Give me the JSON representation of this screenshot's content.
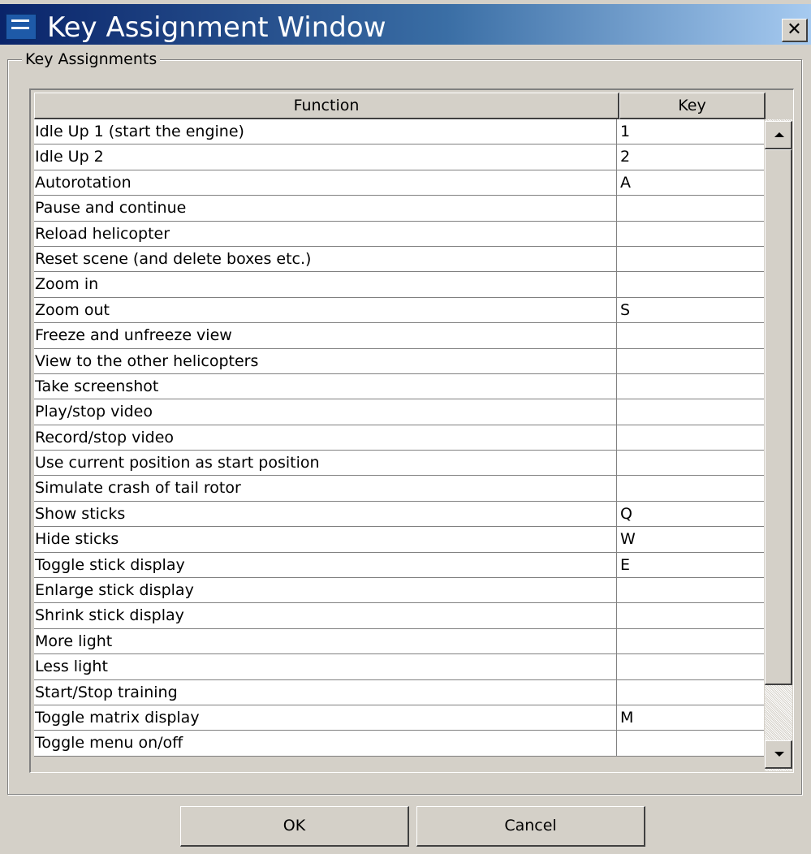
{
  "window": {
    "title": "Key Assignment Window",
    "close_label": "✕"
  },
  "group": {
    "label": "Key Assignments"
  },
  "table": {
    "columns": [
      "Function",
      "Key"
    ],
    "rows": [
      {
        "function": "Idle Up 1 (start the engine)",
        "key": "1"
      },
      {
        "function": "Idle Up 2",
        "key": "2"
      },
      {
        "function": "Autorotation",
        "key": "A"
      },
      {
        "function": "Pause and continue",
        "key": ""
      },
      {
        "function": "Reload helicopter",
        "key": ""
      },
      {
        "function": "Reset scene (and delete boxes etc.)",
        "key": ""
      },
      {
        "function": "Zoom in",
        "key": ""
      },
      {
        "function": "Zoom out",
        "key": "S"
      },
      {
        "function": "Freeze and unfreeze view",
        "key": ""
      },
      {
        "function": "View to the other helicopters",
        "key": ""
      },
      {
        "function": "Take screenshot",
        "key": ""
      },
      {
        "function": "Play/stop video",
        "key": ""
      },
      {
        "function": "Record/stop video",
        "key": ""
      },
      {
        "function": "Use current position as start position",
        "key": ""
      },
      {
        "function": "Simulate crash of tail rotor",
        "key": ""
      },
      {
        "function": "Show sticks",
        "key": "Q"
      },
      {
        "function": "Hide sticks",
        "key": "W"
      },
      {
        "function": "Toggle stick display",
        "key": "E"
      },
      {
        "function": "Enlarge stick display",
        "key": ""
      },
      {
        "function": "Shrink stick display",
        "key": ""
      },
      {
        "function": "More light",
        "key": ""
      },
      {
        "function": "Less light",
        "key": ""
      },
      {
        "function": "Start/Stop training",
        "key": ""
      },
      {
        "function": "Toggle matrix display",
        "key": "M"
      },
      {
        "function": "Toggle menu on/off",
        "key": ""
      }
    ]
  },
  "buttons": {
    "ok": "OK",
    "cancel": "Cancel"
  },
  "colors": {
    "titlebar_start": "#0a246a",
    "titlebar_end": "#a6caf0",
    "dialog_bg": "#d4d0c8"
  }
}
